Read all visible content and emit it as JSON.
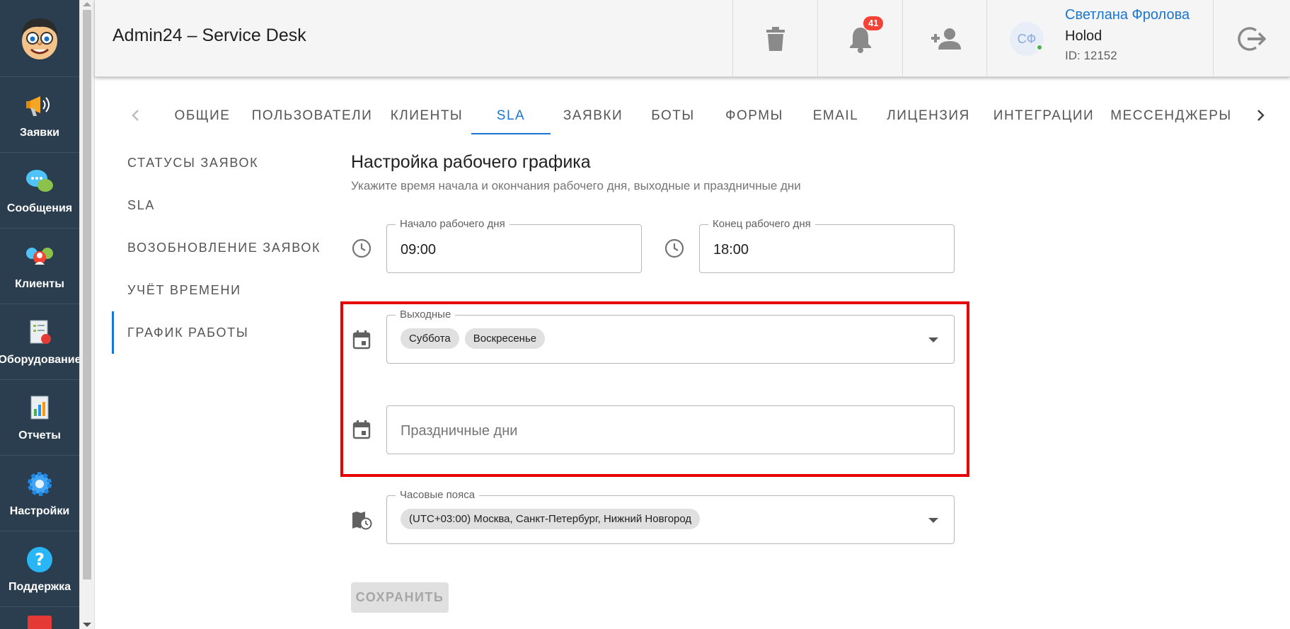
{
  "app": {
    "title": "Admin24 – Service Desk"
  },
  "nav": [
    {
      "label": "Заявки",
      "icon": "megaphone-icon"
    },
    {
      "label": "Сообщения",
      "icon": "chat-bubbles-icon"
    },
    {
      "label": "Клиенты",
      "icon": "clients-icon"
    },
    {
      "label": "Оборудование",
      "icon": "equipment-icon"
    },
    {
      "label": "Отчеты",
      "icon": "reports-icon"
    },
    {
      "label": "Настройки",
      "icon": "gear-icon"
    },
    {
      "label": "Поддержка",
      "icon": "help-icon"
    }
  ],
  "header": {
    "notifications_count": "41",
    "user": {
      "initials": "СФ",
      "name": "Светлана Фролова",
      "org": "Holod",
      "id": "ID: 12152"
    }
  },
  "tabs": [
    "ОБЩИЕ",
    "ПОЛЬЗОВАТЕЛИ",
    "КЛИЕНТЫ",
    "SLA",
    "ЗАЯВКИ",
    "БОТЫ",
    "ФОРМЫ",
    "EMAIL",
    "ЛИЦЕНЗИЯ",
    "ИНТЕГРАЦИИ",
    "МЕССЕНДЖЕРЫ"
  ],
  "active_tab": "SLA",
  "side_menu": [
    "СТАТУСЫ ЗАЯВОК",
    "SLA",
    "ВОЗОБНОВЛЕНИЕ ЗАЯВОК",
    "УЧЁТ ВРЕМЕНИ",
    "ГРАФИК РАБОТЫ"
  ],
  "active_side_item": "ГРАФИК РАБОТЫ",
  "content": {
    "title": "Настройка рабочего графика",
    "subtitle": "Укажите время начала и окончания рабочего дня, выходные и праздничные дни",
    "start": {
      "label": "Начало рабочего дня",
      "value": "09:00"
    },
    "end": {
      "label": "Конец рабочего дня",
      "value": "18:00"
    },
    "weekends": {
      "label": "Выходные",
      "chips": [
        "Суббота",
        "Воскресенье"
      ]
    },
    "holidays": {
      "placeholder": "Праздничные дни"
    },
    "timezones": {
      "label": "Часовые пояса",
      "chips": [
        "(UTC+03:00) Москва, Санкт-Петербург, Нижний Новгород"
      ]
    },
    "save_label": "СОХРАНИТЬ"
  },
  "colors": {
    "accent": "#1976d2",
    "highlight": "#e60000",
    "sidebar": "#2b3e50",
    "badge": "#f44336"
  }
}
